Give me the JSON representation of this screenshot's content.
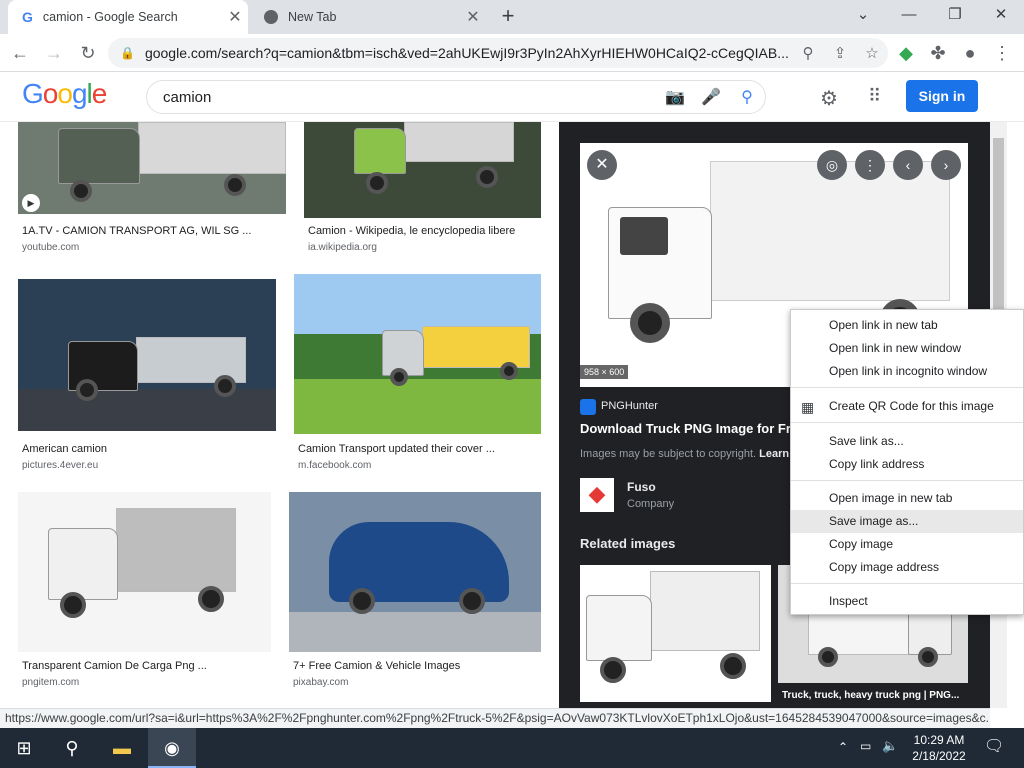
{
  "browser": {
    "tabs": [
      {
        "title": "camion - Google Search",
        "favicon": "google-favicon"
      },
      {
        "title": "New Tab",
        "favicon": "globe-icon"
      }
    ],
    "url": "google.com/search?q=camion&tbm=isch&ved=2ahUKEwjI9r3PyIn2AhXyrHIEHW0HCaIQ2-cCegQIAB...",
    "window_controls": {
      "minimize": "—",
      "restore": "❐",
      "close": "✕"
    }
  },
  "google": {
    "logo": "Google",
    "query": "camion",
    "signin_label": "Sign in"
  },
  "results": [
    {
      "caption": "1A.TV - CAMION TRANSPORT AG, WIL SG ...",
      "source": "youtube.com"
    },
    {
      "caption": "Camion - Wikipedia, le encyclopedia libere",
      "source": "ia.wikipedia.org"
    },
    {
      "caption": "American camion",
      "source": "pictures.4ever.eu"
    },
    {
      "caption": "Camion Transport updated their cover ...",
      "source": "m.facebook.com"
    },
    {
      "caption": "Transparent Camion De Carga Png ...",
      "source": "pngitem.com"
    },
    {
      "caption": "7+ Free Camion & Vehicle Images",
      "source": "pixabay.com"
    }
  ],
  "panel": {
    "dimensions": "958 × 600",
    "site": "PNGHunter",
    "title": "Download Truck PNG Image for Fre",
    "copyright": "Images may be subject to copyright.",
    "learn": "Learn",
    "brand_name": "Fuso",
    "brand_type": "Company",
    "related_heading": "Related images",
    "related_caption": "Truck, truck, heavy truck png | PNG..."
  },
  "context_menu": {
    "items": [
      "Open link in new tab",
      "Open link in new window",
      "Open link in incognito window",
      "Create QR Code for this image",
      "Save link as...",
      "Copy link address",
      "Open image in new tab",
      "Save image as...",
      "Copy image",
      "Copy image address",
      "Inspect"
    ]
  },
  "status_url": "https://www.google.com/url?sa=i&url=https%3A%2F%2Fpnghunter.com%2Fpng%2Ftruck-5%2F&psig=AOvVaw073KTLvlovXoETph1xLOjo&ust=1645284539047000&source=images&c...",
  "taskbar": {
    "time": "10:29 AM",
    "date": "2/18/2022"
  },
  "colors": {
    "accent": "#1a73e8",
    "panel_bg": "#202124",
    "taskbar_bg": "#1f2a36"
  }
}
